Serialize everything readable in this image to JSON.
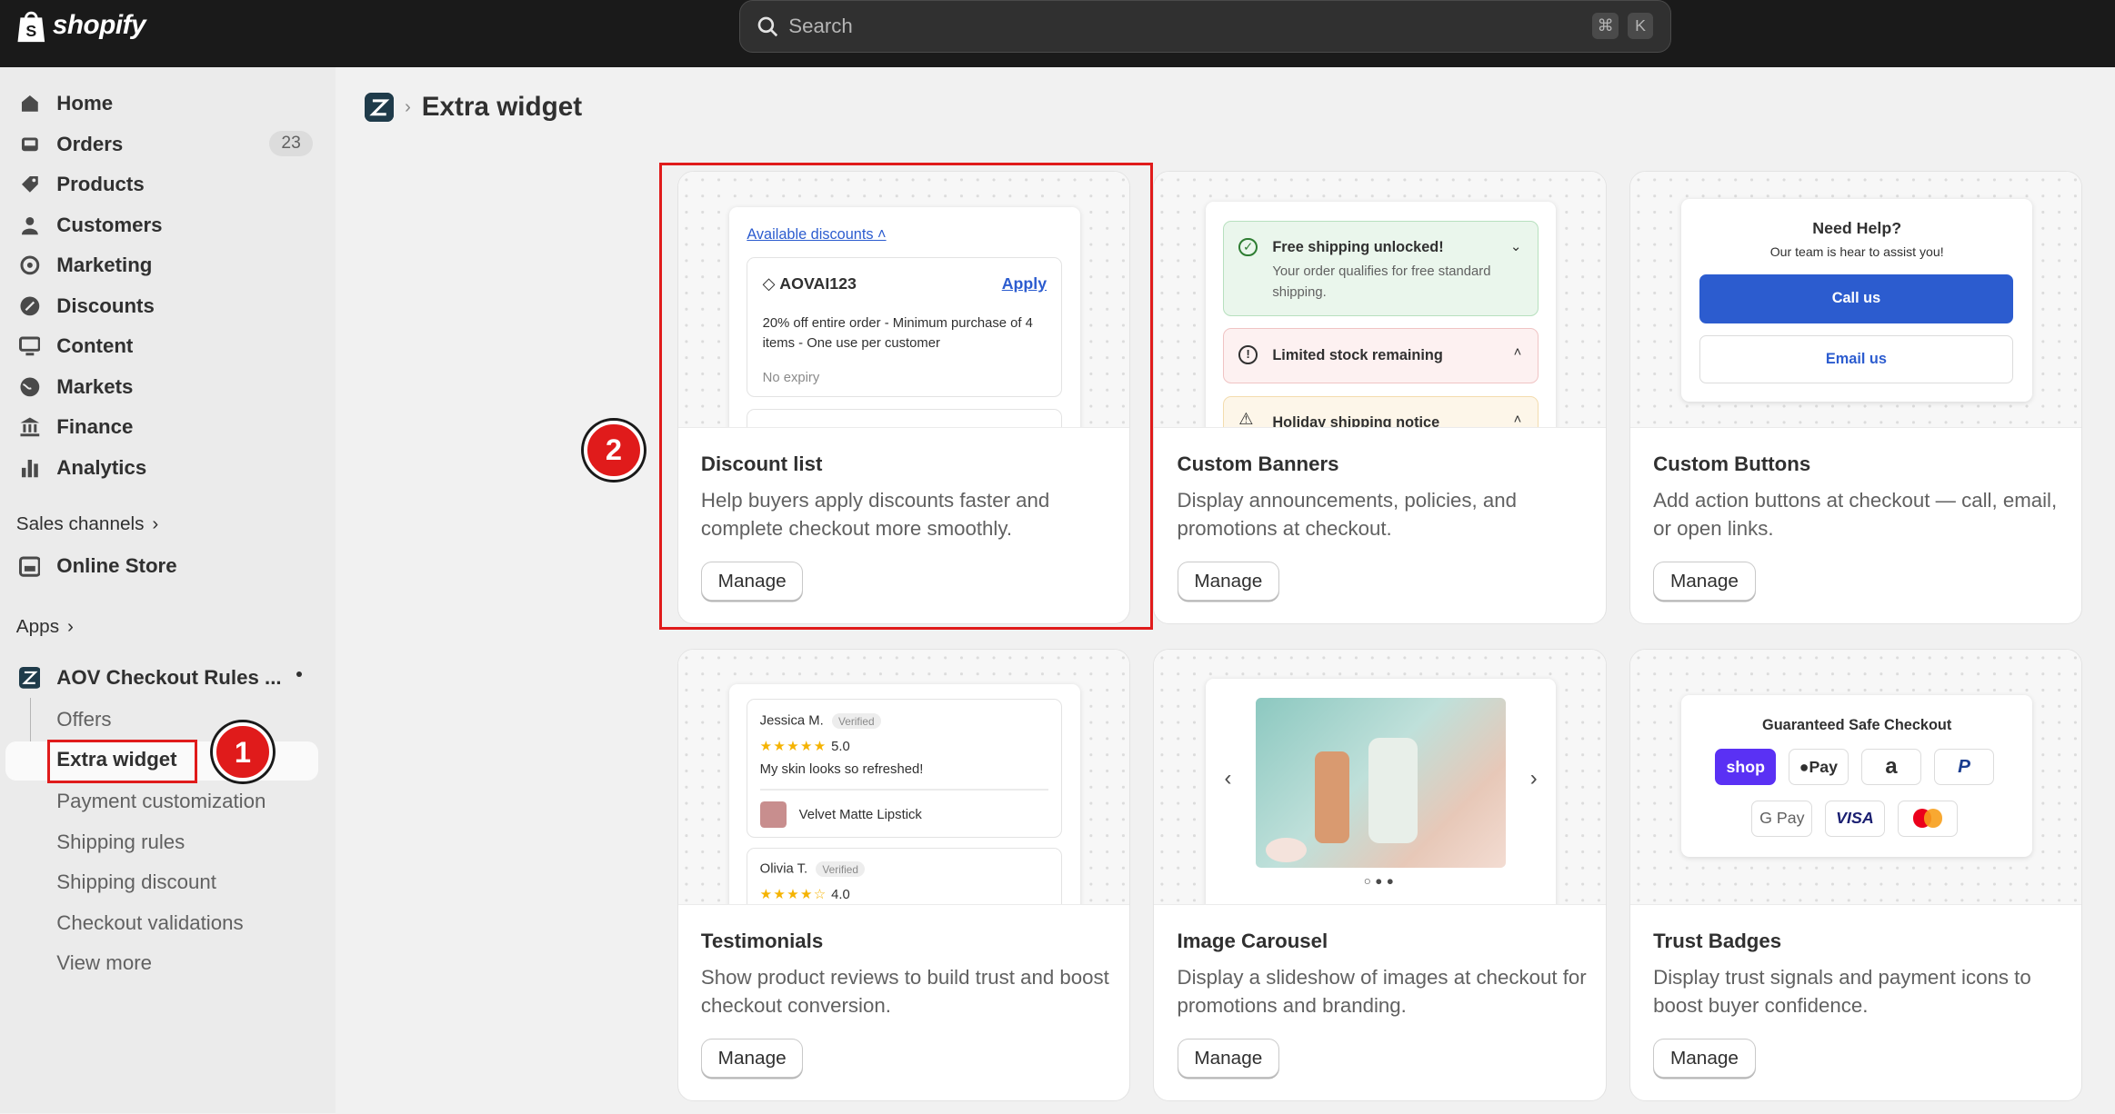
{
  "topbar": {
    "brand": "shopify",
    "search_placeholder": "Search",
    "shortcut_cmd": "⌘",
    "shortcut_key": "K"
  },
  "sidebar": {
    "items": [
      {
        "label": "Home",
        "icon": "home-icon"
      },
      {
        "label": "Orders",
        "icon": "inbox-icon",
        "badge": "23"
      },
      {
        "label": "Products",
        "icon": "tag-icon"
      },
      {
        "label": "Customers",
        "icon": "person-icon"
      },
      {
        "label": "Marketing",
        "icon": "target-icon"
      },
      {
        "label": "Discounts",
        "icon": "discount-icon"
      },
      {
        "label": "Content",
        "icon": "monitor-icon"
      },
      {
        "label": "Markets",
        "icon": "globe-icon"
      },
      {
        "label": "Finance",
        "icon": "bank-icon"
      },
      {
        "label": "Analytics",
        "icon": "bar-chart-icon"
      }
    ],
    "sales_channels_label": "Sales channels",
    "online_store_label": "Online Store",
    "apps_label": "Apps",
    "app_name": "AOV Checkout Rules ...",
    "app_subitems": [
      "Offers",
      "Extra widget",
      "Payment customization",
      "Shipping rules",
      "Shipping discount",
      "Checkout validations",
      "View more"
    ]
  },
  "page": {
    "title": "Extra widget",
    "manage_label": "Manage"
  },
  "cards": [
    {
      "title": "Discount list",
      "desc": "Help buyers apply discounts faster and complete checkout more smoothly."
    },
    {
      "title": "Custom Banners",
      "desc": "Display announcements, policies, and promotions at checkout."
    },
    {
      "title": "Custom Buttons",
      "desc": "Add action buttons at checkout — call, email, or open links."
    },
    {
      "title": "Testimonials",
      "desc": "Show product reviews to build trust and boost checkout conversion."
    },
    {
      "title": "Image Carousel",
      "desc": "Display a slideshow of images at checkout for promotions and branding."
    },
    {
      "title": "Trust Badges",
      "desc": "Display trust signals and payment icons to boost buyer confidence."
    }
  ],
  "previews": {
    "discount": {
      "link": "Available discounts",
      "code": "AOVAI123",
      "apply": "Apply",
      "detail": "20% off entire order - Minimum purchase of 4 items - One use per customer",
      "expiry": "No expiry"
    },
    "banners": {
      "b1_title": "Free shipping unlocked!",
      "b1_text": "Your order qualifies for free standard shipping.",
      "b2_title": "Limited stock remaining",
      "b3_title": "Holiday shipping notice"
    },
    "buttons": {
      "heading": "Need Help?",
      "sub": "Our team is hear to assist you!",
      "primary": "Call us",
      "secondary": "Email us"
    },
    "testimonials": {
      "r1_name": "Jessica M.",
      "r1_badge": "Verified",
      "r1_rating": "5.0",
      "r1_text": "My skin looks so refreshed!",
      "r1_product": "Velvet Matte Lipstick",
      "r2_name": "Olivia T.",
      "r2_badge": "Verified",
      "r2_rating": "4.0"
    },
    "trust": {
      "heading": "Guaranteed Safe Checkout",
      "shop": "shop",
      "applepay": "Pay",
      "gpay": "G Pay",
      "visa": "VISA"
    }
  },
  "annotations": {
    "m1": "1",
    "m2": "2"
  },
  "colors": {
    "accent_blue": "#2c5ccf",
    "annotation_red": "#e01b1b",
    "success_green": "#eaf6ec"
  }
}
